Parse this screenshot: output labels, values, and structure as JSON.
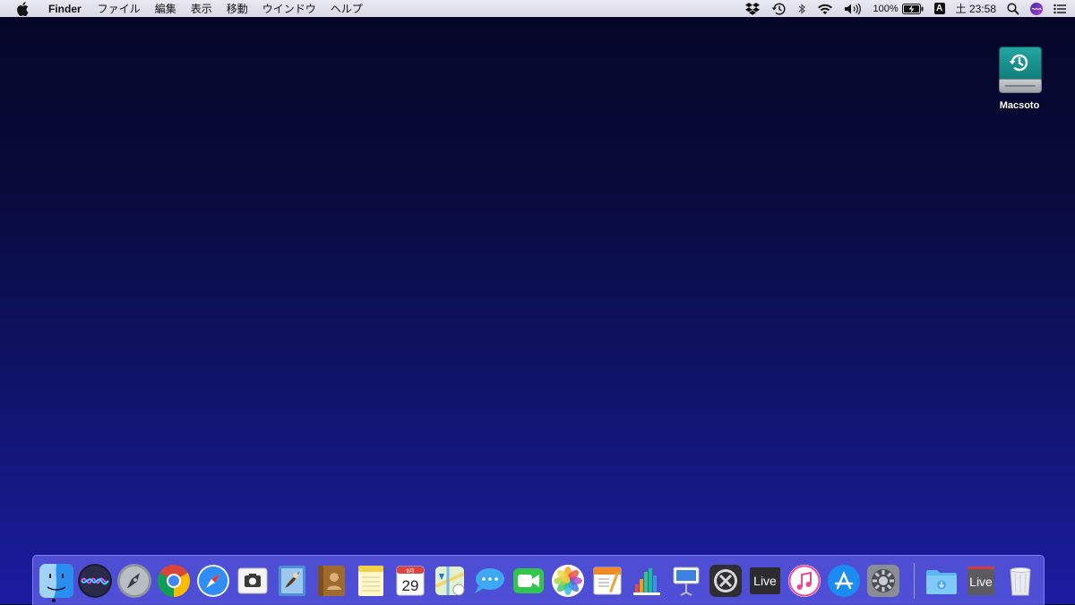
{
  "menubar": {
    "app_name": "Finder",
    "menus": [
      "ファイル",
      "編集",
      "表示",
      "移動",
      "ウインドウ",
      "ヘルプ"
    ],
    "battery_percent": "100%",
    "input_source": "A",
    "clock": "土 23:58"
  },
  "desktop": {
    "icons": [
      {
        "label": "Macsoto",
        "icon": "time-machine-drive-icon"
      }
    ]
  },
  "calendar": {
    "month": "9月",
    "day": "29"
  },
  "dock": {
    "items": [
      {
        "name": "finder",
        "icon": "finder-icon",
        "running": true
      },
      {
        "name": "siri",
        "icon": "siri-icon"
      },
      {
        "name": "launchpad",
        "icon": "launchpad-icon"
      },
      {
        "name": "chrome",
        "icon": "chrome-icon"
      },
      {
        "name": "safari",
        "icon": "safari-icon"
      },
      {
        "name": "screenshot",
        "icon": "screenshot-icon"
      },
      {
        "name": "mail",
        "icon": "mail-icon"
      },
      {
        "name": "contacts",
        "icon": "contacts-icon"
      },
      {
        "name": "notes",
        "icon": "notes-icon"
      },
      {
        "name": "calendar",
        "icon": "calendar-icon"
      },
      {
        "name": "maps",
        "icon": "maps-icon"
      },
      {
        "name": "messages",
        "icon": "messages-icon"
      },
      {
        "name": "facetime",
        "icon": "facetime-icon"
      },
      {
        "name": "photos",
        "icon": "photos-icon"
      },
      {
        "name": "pages",
        "icon": "pages-icon"
      },
      {
        "name": "numbers",
        "icon": "numbers-icon"
      },
      {
        "name": "keynote",
        "icon": "keynote-icon"
      },
      {
        "name": "switch",
        "icon": "switch-icon"
      },
      {
        "name": "ableton-live",
        "icon": "live-icon",
        "text": "Live"
      },
      {
        "name": "itunes",
        "icon": "itunes-icon"
      },
      {
        "name": "app-store",
        "icon": "app-store-icon"
      },
      {
        "name": "system-preferences",
        "icon": "gear-icon"
      },
      {
        "name": "downloads",
        "icon": "downloads-folder-icon"
      },
      {
        "name": "live-document",
        "icon": "live-document-icon",
        "text": "Live"
      },
      {
        "name": "trash",
        "icon": "trash-icon"
      }
    ]
  }
}
